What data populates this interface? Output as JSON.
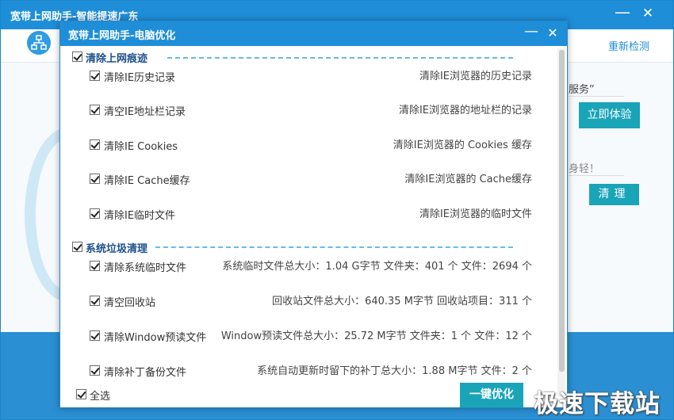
{
  "main_window": {
    "title": "宽带上网助手-智能提速广东",
    "min_glyph": "—",
    "close_glyph": "✕",
    "recheck_label": "重新检测",
    "service_fragment": "服务”",
    "try_button_label": "立即体验",
    "light_fragment": "身轻！",
    "clean_button_label": "清理"
  },
  "dialog": {
    "title": "宽带上网助手-电脑优化",
    "min_glyph": "—",
    "close_glyph": "✕",
    "sections": [
      {
        "title": "清除上网痕迹",
        "checked": true,
        "items": [
          {
            "label": "清除IE历史记录",
            "desc": "清除IE浏览器的历史记录",
            "checked": true
          },
          {
            "label": "清空IE地址栏记录",
            "desc": "清除IE浏览器的地址栏的记录",
            "checked": true
          },
          {
            "label": "清除IE Cookies",
            "desc": "清除IE浏览器的 Cookies 缓存",
            "checked": true
          },
          {
            "label": "清除IE Cache缓存",
            "desc": "清除IE浏览器的 Cache缓存",
            "checked": true
          },
          {
            "label": "清除IE临时文件",
            "desc": "清除IE浏览器的临时文件",
            "checked": true
          }
        ]
      },
      {
        "title": "系统垃圾清理",
        "checked": true,
        "items": [
          {
            "label": "清除系统临时文件",
            "desc": "系统临时文件总大小：1.04 G字节  文件夹：401 个 文件：2694 个",
            "checked": true
          },
          {
            "label": "清空回收站",
            "desc": "回收站文件总大小：640.35 M字节  回收站项目：311 个",
            "checked": true
          },
          {
            "label": "清除Window预读文件",
            "desc": "Window预读文件总大小：25.72 M字节  文件夹：1 个 文件：12 个",
            "checked": true
          },
          {
            "label": "清除补丁备份文件",
            "desc": "系统自动更新时留下的补丁总大小：1.88 M字节  文件：2 个",
            "checked": true
          }
        ]
      }
    ],
    "select_all_label": "全选",
    "select_all_checked": true,
    "onekey_button_label": "一键优化"
  },
  "watermark": "极速下载站",
  "icons": {
    "network_logo": "network-topology-icon",
    "checkbox": "checkbox-checked-icon"
  },
  "colors": {
    "title_blue": "#1e8ed8",
    "button_teal": "#1aa4b8",
    "section_title": "#1c4f8a"
  }
}
